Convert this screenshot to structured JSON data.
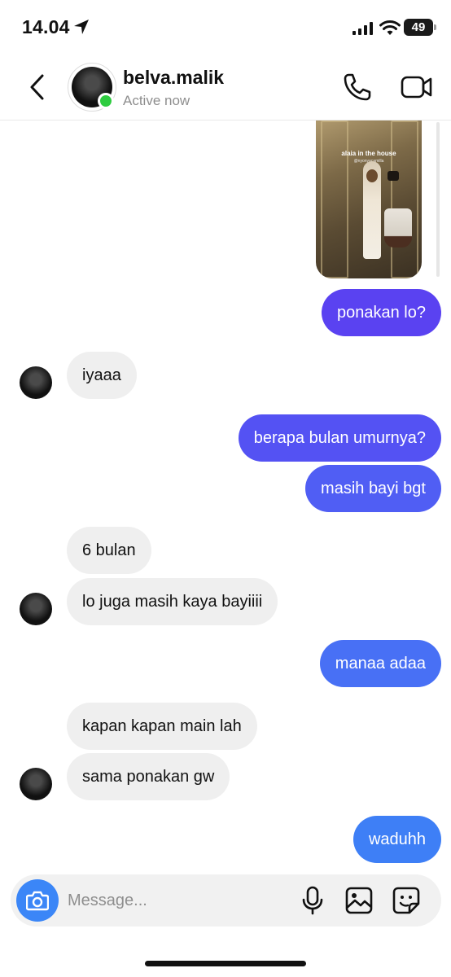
{
  "status_bar": {
    "time": "14.04",
    "battery": "49"
  },
  "header": {
    "contact_name": "belva.malik",
    "contact_status": "Active now"
  },
  "shared_media": {
    "caption": "alaia in the house",
    "subcaption": "@nyonyacamilla"
  },
  "messages": [
    {
      "from": "me",
      "text": "ponakan lo?"
    },
    {
      "from": "them",
      "text": "iyaaa"
    },
    {
      "from": "me",
      "text": "berapa bulan umurnya?"
    },
    {
      "from": "me",
      "text": "masih bayi bgt"
    },
    {
      "from": "them",
      "text": "6 bulan"
    },
    {
      "from": "them",
      "text": "lo juga masih kaya bayiiii"
    },
    {
      "from": "me",
      "text": "manaa adaa"
    },
    {
      "from": "them",
      "text": "kapan kapan main lah"
    },
    {
      "from": "them",
      "text": "sama ponakan gw"
    },
    {
      "from": "me",
      "text": "waduhh"
    }
  ],
  "composer": {
    "placeholder": "Message..."
  },
  "colors": {
    "sent_bubble_top": "#5d3ef2",
    "sent_bubble_bottom": "#3b82f6",
    "received_bubble": "#efefef",
    "online_dot": "#2ecc40",
    "camera_button": "#3b86f7"
  },
  "icons": [
    "location-arrow-icon",
    "signal-icon",
    "wifi-icon",
    "back-chevron-icon",
    "phone-icon",
    "video-camera-icon",
    "camera-icon",
    "microphone-icon",
    "gallery-icon",
    "sticker-icon"
  ]
}
